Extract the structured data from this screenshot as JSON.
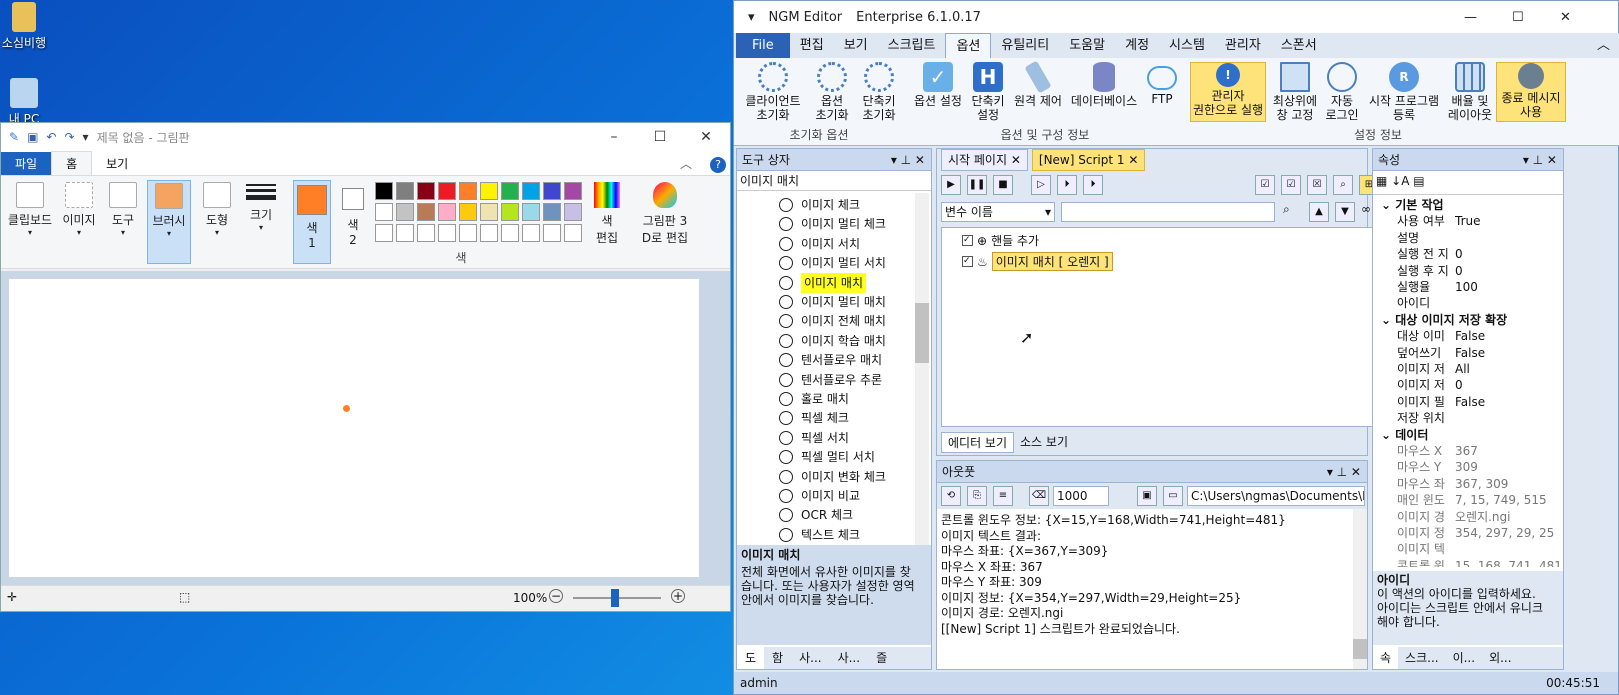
{
  "desktop": {
    "icons": [
      {
        "label": "소심비행"
      },
      {
        "label": "내 PC"
      }
    ]
  },
  "paint": {
    "title": "제목 없음 - 그림판",
    "tabs": [
      "파일",
      "홈",
      "보기"
    ],
    "ribbon": {
      "clipboard": "클립보드",
      "image": "이미지",
      "tools": "도구",
      "brushes": "브러시",
      "shapes": "도형",
      "size": "크기",
      "color1": "색\n1",
      "color1_a": "색",
      "color1_b": "1",
      "color2_a": "색",
      "color2_b": "2",
      "colors_group": "색",
      "edit_colors_a": "색",
      "edit_colors_b": "편집",
      "paint3d_a": "그림판 3",
      "paint3d_b": "D로 편집"
    },
    "palette": [
      "#000000",
      "#7f7f7f",
      "#880015",
      "#ed1c24",
      "#ff7f27",
      "#fff200",
      "#22b14c",
      "#00a2e8",
      "#3f48cc",
      "#a349a4",
      "#ffffff",
      "#c3c3c3",
      "#b97a57",
      "#ffaec9",
      "#ffc90e",
      "#efe4b0",
      "#b5e61d",
      "#99d9ea",
      "#7092be",
      "#c8bfe7"
    ],
    "color1": "#ff7f27",
    "zoom": "100%"
  },
  "ngm": {
    "title": "NGM Editor",
    "edition": "Enterprise 6.1.0.17",
    "menu": [
      "File",
      "편집",
      "보기",
      "스크립트",
      "옵션",
      "유틸리티",
      "도움말",
      "계정",
      "시스템",
      "관리자",
      "스폰서"
    ],
    "ribbon": {
      "b1": [
        "클라이언트",
        "초기화"
      ],
      "b2": [
        "옵션",
        "초기화"
      ],
      "b3": [
        "단축키",
        "초기화"
      ],
      "g1": "초기화 옵션",
      "b4": [
        "옵션 설정",
        ""
      ],
      "b5": [
        "단축키",
        "설정"
      ],
      "b6": [
        "원격 제어",
        ""
      ],
      "b7": [
        "데이터베이스",
        ""
      ],
      "b8": [
        "FTP",
        ""
      ],
      "g2": "옵션 및 구성 정보",
      "b9": [
        "관리자",
        "권한으로 실행"
      ],
      "b10": [
        "최상위에",
        "창 고정"
      ],
      "b11": [
        "자동",
        "로그인"
      ],
      "b12": [
        "시작 프로그램",
        "등록"
      ],
      "b13": [
        "배율 및",
        "레이아웃"
      ],
      "b14": [
        "종료 메시지",
        "사용"
      ],
      "g3": "설정 정보"
    },
    "toolbox": {
      "header": "도구 상자",
      "search": "이미지 매치",
      "items": [
        "이미지 체크",
        "이미지 멀티 체크",
        "이미지 서치",
        "이미지 멀티 서치",
        "이미지 매치",
        "이미지 멀티 매치",
        "이미지 전체 매치",
        "이미지 학습 매치",
        "텐서플로우 매치",
        "텐서플로우 추론",
        "홀로 매치",
        "픽셀 체크",
        "픽셀 서치",
        "픽셀 멀티 서치",
        "이미지 변화 체크",
        "이미지 비교",
        "OCR 체크",
        "텍스트 체크"
      ],
      "desc_title": "이미지 매치",
      "desc_lines": [
        "전체 화면에서 유사한 이미지를 찾",
        "습니다. 또는 사용자가 설정한 영역",
        "안에서 이미지를 찾습니다."
      ],
      "bottom_tabs": [
        "도",
        "함",
        "사...",
        "사...",
        "즐"
      ]
    },
    "editor": {
      "tabs": [
        "시작 페이지",
        "[New] Script 1"
      ],
      "var_select": "변수 이름",
      "nodes": [
        "핸들 추가",
        "이미지 매치 [ 오렌지 ]"
      ],
      "bottom_tabs": [
        "에디터 보기",
        "소스 보기"
      ]
    },
    "output": {
      "header": "아웃풋",
      "count": "1000",
      "path": "C:\\Users\\ngmas\\Documents\\NGM6\\",
      "lines": [
        "콘트롤 윈도우 정보: {X=15,Y=168,Width=741,Height=481}",
        "이미지 텍스트 결과:",
        "마우스 좌표: {X=367,Y=309}",
        "마우스 X 좌표: 367",
        "마우스 Y 좌표: 309",
        "이미지 정보: {X=354,Y=297,Width=29,Height=25}",
        "이미지 경로: 오렌지.ngi",
        "[[New] Script 1] 스크립트가 완료되었습니다."
      ]
    },
    "props": {
      "header": "속성",
      "cats": [
        "기본 작업",
        "대상 이미지 저장 확장",
        "데이터"
      ],
      "basic": [
        [
          "사용 여부",
          "True"
        ],
        [
          "설명",
          ""
        ],
        [
          "실행 전 지",
          "0"
        ],
        [
          "실행 후 지",
          "0"
        ],
        [
          "실행율",
          "100"
        ],
        [
          "아이디",
          ""
        ]
      ],
      "save": [
        [
          "대상 이미",
          "False"
        ],
        [
          "덮어쓰기",
          "False"
        ],
        [
          "이미지 저",
          "All"
        ],
        [
          "이미지 저",
          "0"
        ],
        [
          "이미지 필",
          "False"
        ],
        [
          "저장 위치",
          ""
        ]
      ],
      "data": [
        [
          "마우스 X",
          "367"
        ],
        [
          "마우스 Y",
          "309"
        ],
        [
          "마우스 좌",
          "367, 309"
        ],
        [
          "매인 윈도",
          "7, 15, 749, 515"
        ],
        [
          "이미지 경",
          "오렌지.ngi"
        ],
        [
          "이미지 정",
          "354, 297, 29, 25"
        ],
        [
          "이미지 텍",
          ""
        ],
        [
          "콘트롤 윈",
          "15, 168, 741, 481"
        ]
      ],
      "desc_title": "아이디",
      "desc_lines": [
        "이 액션의 아이디를 입력하세요.",
        "아이디는 스크립트 안에서 유니크",
        "해야 합니다."
      ],
      "bottom_tabs": [
        "속",
        "스크...",
        "이...",
        "외..."
      ]
    },
    "status_user": "admin",
    "status_time": "00:45:51"
  }
}
